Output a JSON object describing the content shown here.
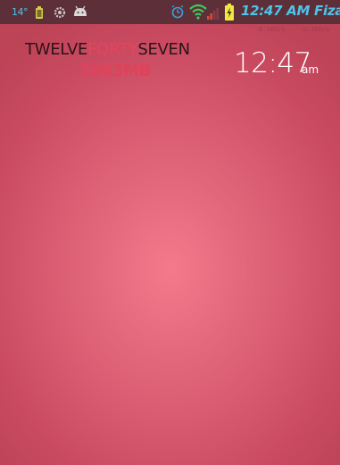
{
  "status_bar": {
    "temperature": "14°",
    "time": "12:47 AM Fiza",
    "icons": [
      "battery-small-icon",
      "gear-icon",
      "android-icon",
      "alarm-icon",
      "wifi-icon",
      "signal-icon",
      "battery-charging-icon"
    ],
    "colors": {
      "background": "#5d2f39",
      "accent": "#4fc3e8"
    }
  },
  "net_speed": {
    "down": "D:1Kb/s",
    "up": "U:1Kb/s"
  },
  "word_clock": {
    "hour": "TWELVE",
    "minutes": "FORTY",
    "seconds": "SEVEN",
    "memory": "1063MB",
    "colors": {
      "text": "#2a1418",
      "highlight": "#e8425c"
    }
  },
  "digital_clock": {
    "time": "12:47",
    "ampm": "am"
  },
  "wallpaper": {
    "center_color": "#f47a8b",
    "edge_color": "#bd4357"
  }
}
